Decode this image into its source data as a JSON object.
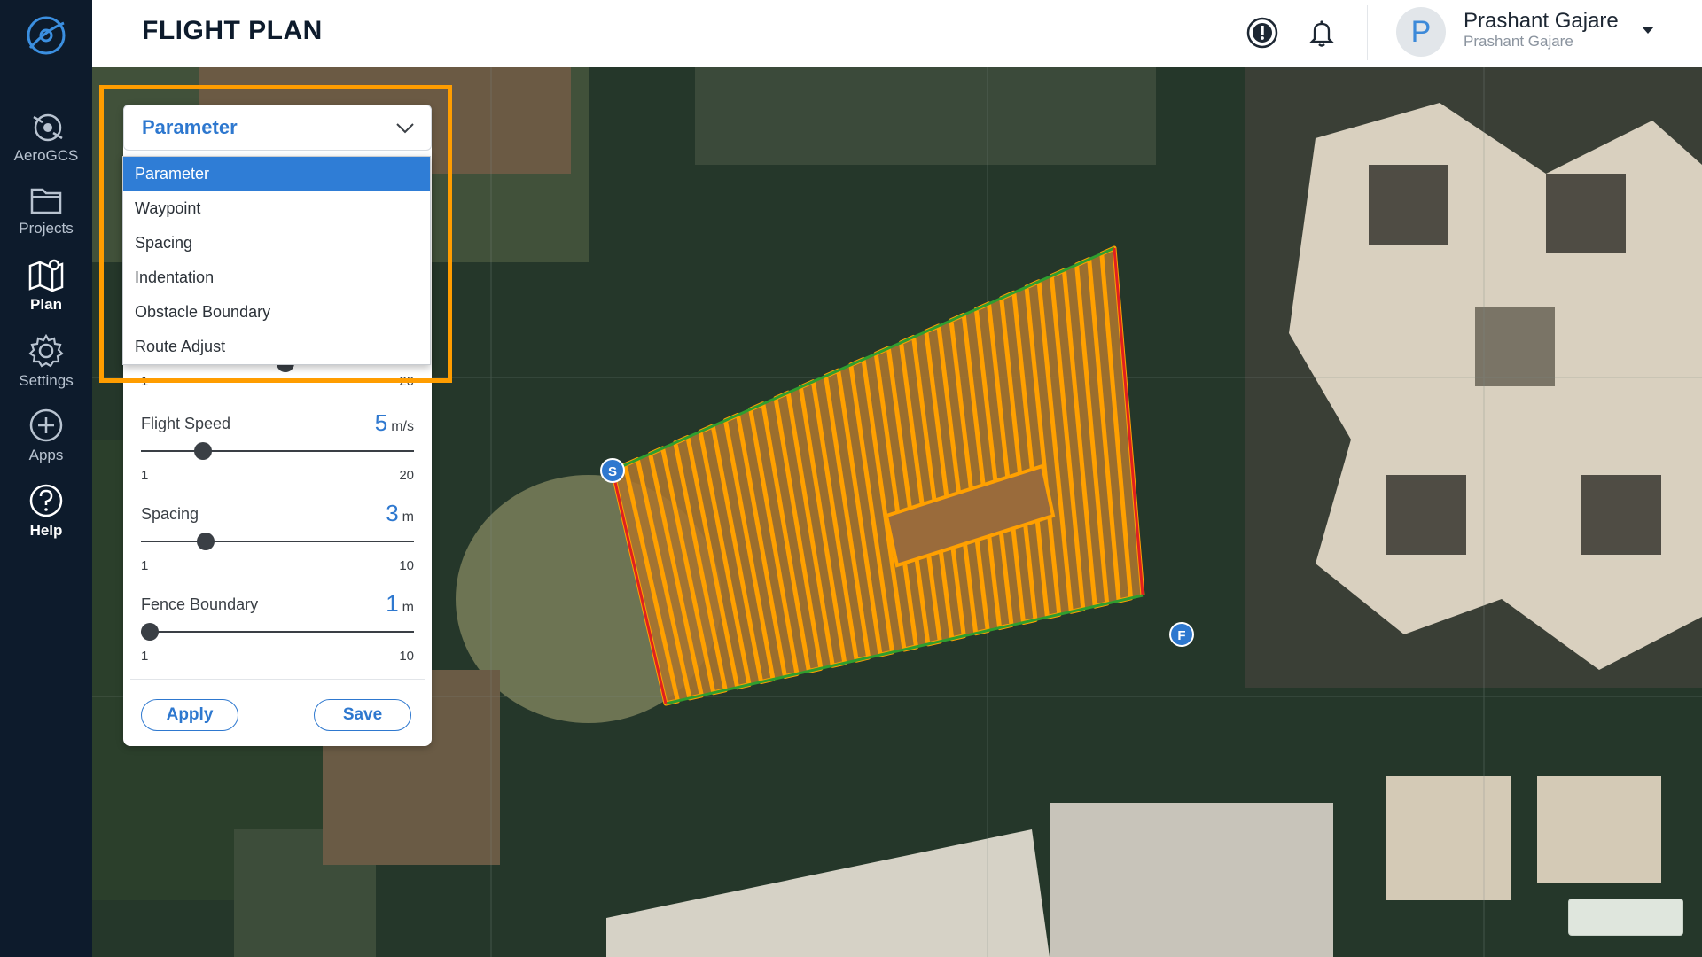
{
  "header": {
    "title": "FLIGHT PLAN",
    "user_name": "Prashant Gajare",
    "user_sub": "Prashant Gajare",
    "avatar_initial": "P"
  },
  "sidebar": {
    "items": [
      {
        "label": "AeroGCS",
        "icon": "drone-icon"
      },
      {
        "label": "Projects",
        "icon": "folder-icon"
      },
      {
        "label": "Plan",
        "icon": "map-icon",
        "active": true
      },
      {
        "label": "Settings",
        "icon": "gear-icon"
      },
      {
        "label": "Apps",
        "icon": "plus-circle-icon"
      },
      {
        "label": "Help",
        "icon": "help-icon"
      }
    ]
  },
  "panel": {
    "dropdown_value": "Parameter",
    "dropdown_options": [
      "Parameter",
      "Waypoint",
      "Spacing",
      "Indentation",
      "Obstacle Boundary",
      "Route Adjust"
    ],
    "hidden_row": {
      "min": "1",
      "max": "20"
    },
    "params": [
      {
        "label": "Flight Speed",
        "value": "5",
        "unit": "m/s",
        "min": "1",
        "max": "20",
        "level": 0.21
      },
      {
        "label": "Spacing",
        "value": "3",
        "unit": "m",
        "min": "1",
        "max": "10",
        "level": 0.22
      },
      {
        "label": "Fence Boundary",
        "value": "1",
        "unit": "m",
        "min": "1",
        "max": "10",
        "level": 0.0
      }
    ],
    "apply_label": "Apply",
    "save_label": "Save"
  },
  "map": {
    "start_marker": "S",
    "finish_marker": "F"
  },
  "colors": {
    "accent": "#2e78cf",
    "sidebar_bg": "#0d1b2c",
    "highlight": "#ff9d00",
    "flight_path": "#ffa000",
    "boundary_green": "#2f9e2f",
    "boundary_red": "#e02020"
  }
}
